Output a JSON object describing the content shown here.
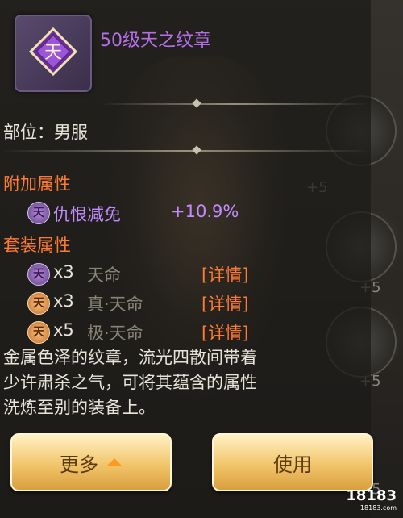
{
  "item": {
    "title": "50级天之纹章",
    "emblem_char": "天",
    "slot_label": "部位：男服"
  },
  "attributes": {
    "heading": "附加属性",
    "list": [
      {
        "icon": "天",
        "name": "仇恨减免",
        "value": "+10.9%"
      }
    ]
  },
  "set": {
    "heading": "套装属性",
    "list": [
      {
        "icon": "天",
        "count": "x3",
        "name": "天命",
        "detail": "[详情]"
      },
      {
        "icon": "天",
        "count": "x3",
        "name": "真·天命",
        "detail": "[详情]"
      },
      {
        "icon": "天",
        "count": "x5",
        "name": "极·天命",
        "detail": "[详情]"
      }
    ]
  },
  "description": [
    "金属色泽的纹章，流光四散间带着",
    "少许肃杀之气，可将其蕴含的属性",
    "洗炼至别的装备上。"
  ],
  "buttons": {
    "more": "更多",
    "use": "使用"
  },
  "background": {
    "plus_labels": [
      "+5",
      "+5",
      "+5",
      "+5"
    ]
  },
  "watermark": {
    "logo": "18183",
    "sub": "18183.com"
  },
  "colors": {
    "title": "#b66ee8",
    "heading": "#ff7a33",
    "attr": "#c28bff",
    "text": "#e8e4da",
    "dim": "#8a8478"
  }
}
